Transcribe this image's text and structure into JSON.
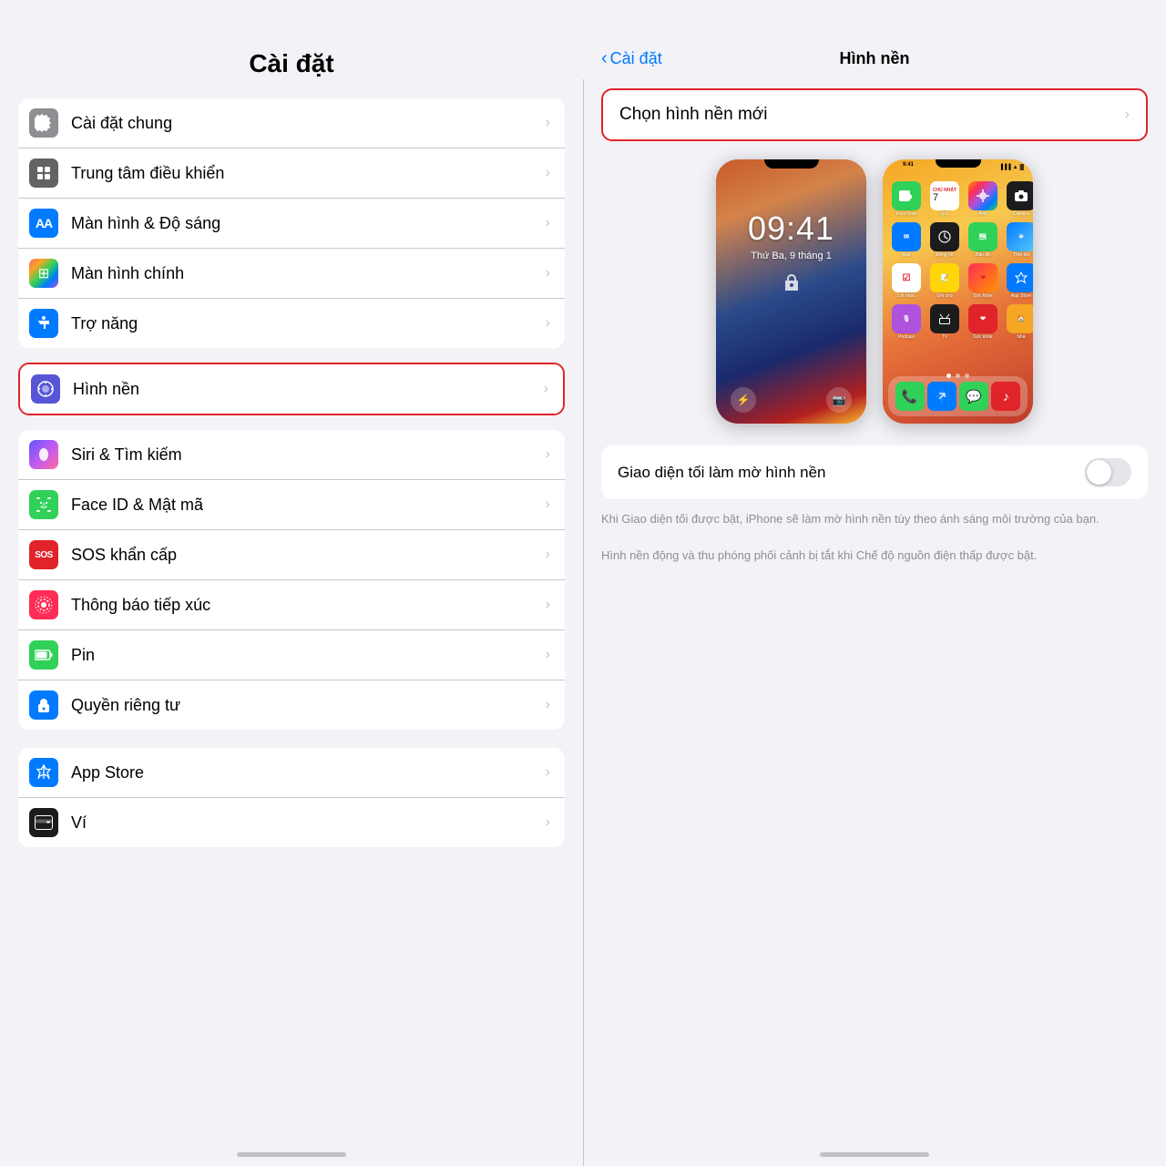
{
  "left": {
    "header": "Cài đặt",
    "groups": [
      {
        "items": [
          {
            "id": "general",
            "label": "Cài đặt chung",
            "iconType": "gray",
            "iconSymbol": "⚙️"
          },
          {
            "id": "control-center",
            "label": "Trung tâm điều khiển",
            "iconType": "dark-gray",
            "iconSymbol": "⊟"
          },
          {
            "id": "display",
            "label": "Màn hình & Độ sáng",
            "iconType": "blue",
            "iconSymbol": "AA"
          },
          {
            "id": "home-screen",
            "label": "Màn hình chính",
            "iconType": "colorful",
            "iconSymbol": "⊞"
          },
          {
            "id": "accessibility",
            "label": "Trợ năng",
            "iconType": "accessibility-blue",
            "iconSymbol": "♿"
          }
        ]
      },
      {
        "highlighted": true,
        "items": [
          {
            "id": "wallpaper",
            "label": "Hình nền",
            "iconType": "wallpaper-blue",
            "iconSymbol": "✿",
            "highlighted": true
          }
        ]
      },
      {
        "items": [
          {
            "id": "siri",
            "label": "Siri & Tìm kiếm",
            "iconType": "siri-purple",
            "iconSymbol": "◉"
          },
          {
            "id": "face-id",
            "label": "Face ID & Mật mã",
            "iconType": "face-green",
            "iconSymbol": "☺"
          },
          {
            "id": "sos",
            "label": "SOS khẩn cấp",
            "iconType": "sos-red",
            "iconSymbol": "SOS"
          },
          {
            "id": "exposure",
            "label": "Thông báo tiếp xúc",
            "iconType": "contact-pink",
            "iconSymbol": "⊙"
          },
          {
            "id": "battery",
            "label": "Pin",
            "iconType": "battery-green",
            "iconSymbol": "▬"
          },
          {
            "id": "privacy",
            "label": "Quyền riêng tư",
            "iconType": "privacy-blue",
            "iconSymbol": "✋"
          }
        ]
      },
      {
        "items": [
          {
            "id": "app-store",
            "label": "App Store",
            "iconType": "appstore-blue",
            "iconSymbol": "A"
          },
          {
            "id": "wallet",
            "label": "Ví",
            "iconType": "wallet-dark",
            "iconSymbol": "▤"
          }
        ]
      }
    ]
  },
  "right": {
    "back_label": "Cài đặt",
    "title": "Hình nền",
    "choose_wallpaper": "Chọn hình nền mới",
    "toggle_label": "Giao diện tối làm mờ hình nền",
    "toggle_state": false,
    "description1": "Khi Giao diện tối được bật, iPhone sẽ làm mờ hình nền tùy theo ánh sáng môi trường của bạn.",
    "description2": "Hình nền động và thu phóng phối cảnh bị tắt khi Chế độ nguồn điện thấp được bật.",
    "lockscreen": {
      "time": "09:41",
      "date": "Thứ Ba, 9 tháng 1"
    }
  }
}
